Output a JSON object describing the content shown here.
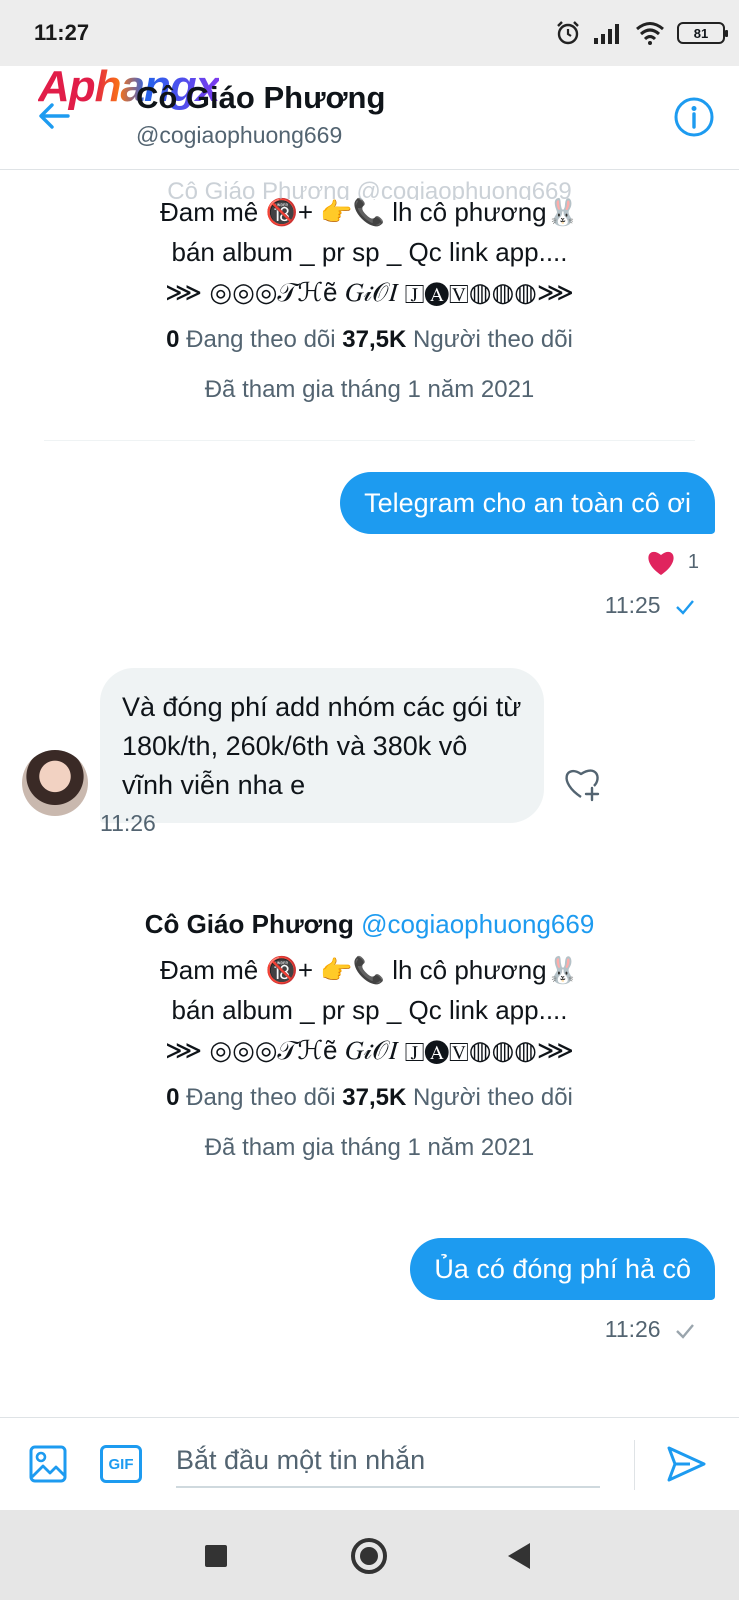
{
  "status_bar": {
    "time": "11:27",
    "battery": "81"
  },
  "header": {
    "watermark": "Aphangx",
    "name": "Cô Giáo Phương",
    "handle": "@cogiaophuong669"
  },
  "profile_card": {
    "name": "Cô Giáo Phương",
    "handle": "@cogiaophuong669",
    "bio_line1": "Đam mê 🔞+ 👉📞 lh cô phương🐰",
    "bio_line2": "bán album _ pr sp _ Qc link app....",
    "bio_line3": "⋙ ◎◎◎𝒯ℋẽ 𝐺𝒾𝒪𝐼 🄹🅐🅅◍◍◍⋙",
    "following_count": "0",
    "following_label": "Đang theo dõi",
    "followers_count": "37,5K",
    "followers_label": "Người theo dõi",
    "joined": "Đã tham gia tháng 1 năm 2021"
  },
  "messages": [
    {
      "direction": "out",
      "text": "Telegram cho an toàn cô ơi",
      "time": "11:25",
      "reaction_count": "1"
    },
    {
      "direction": "in",
      "text": "Và đóng phí add nhóm các gói từ 180k/th, 260k/6th và 380k vô vĩnh viễn nha e",
      "time": "11:26"
    },
    {
      "direction": "out",
      "text": "Ủa có đóng phí hả cô",
      "time": "11:26"
    }
  ],
  "composer": {
    "placeholder": "Bắt đầu một tin nhắn",
    "gif_label": "GIF"
  },
  "colors": {
    "accent": "#1d9bf0",
    "bubble_in": "#eff3f4",
    "heart": "#f91880"
  }
}
